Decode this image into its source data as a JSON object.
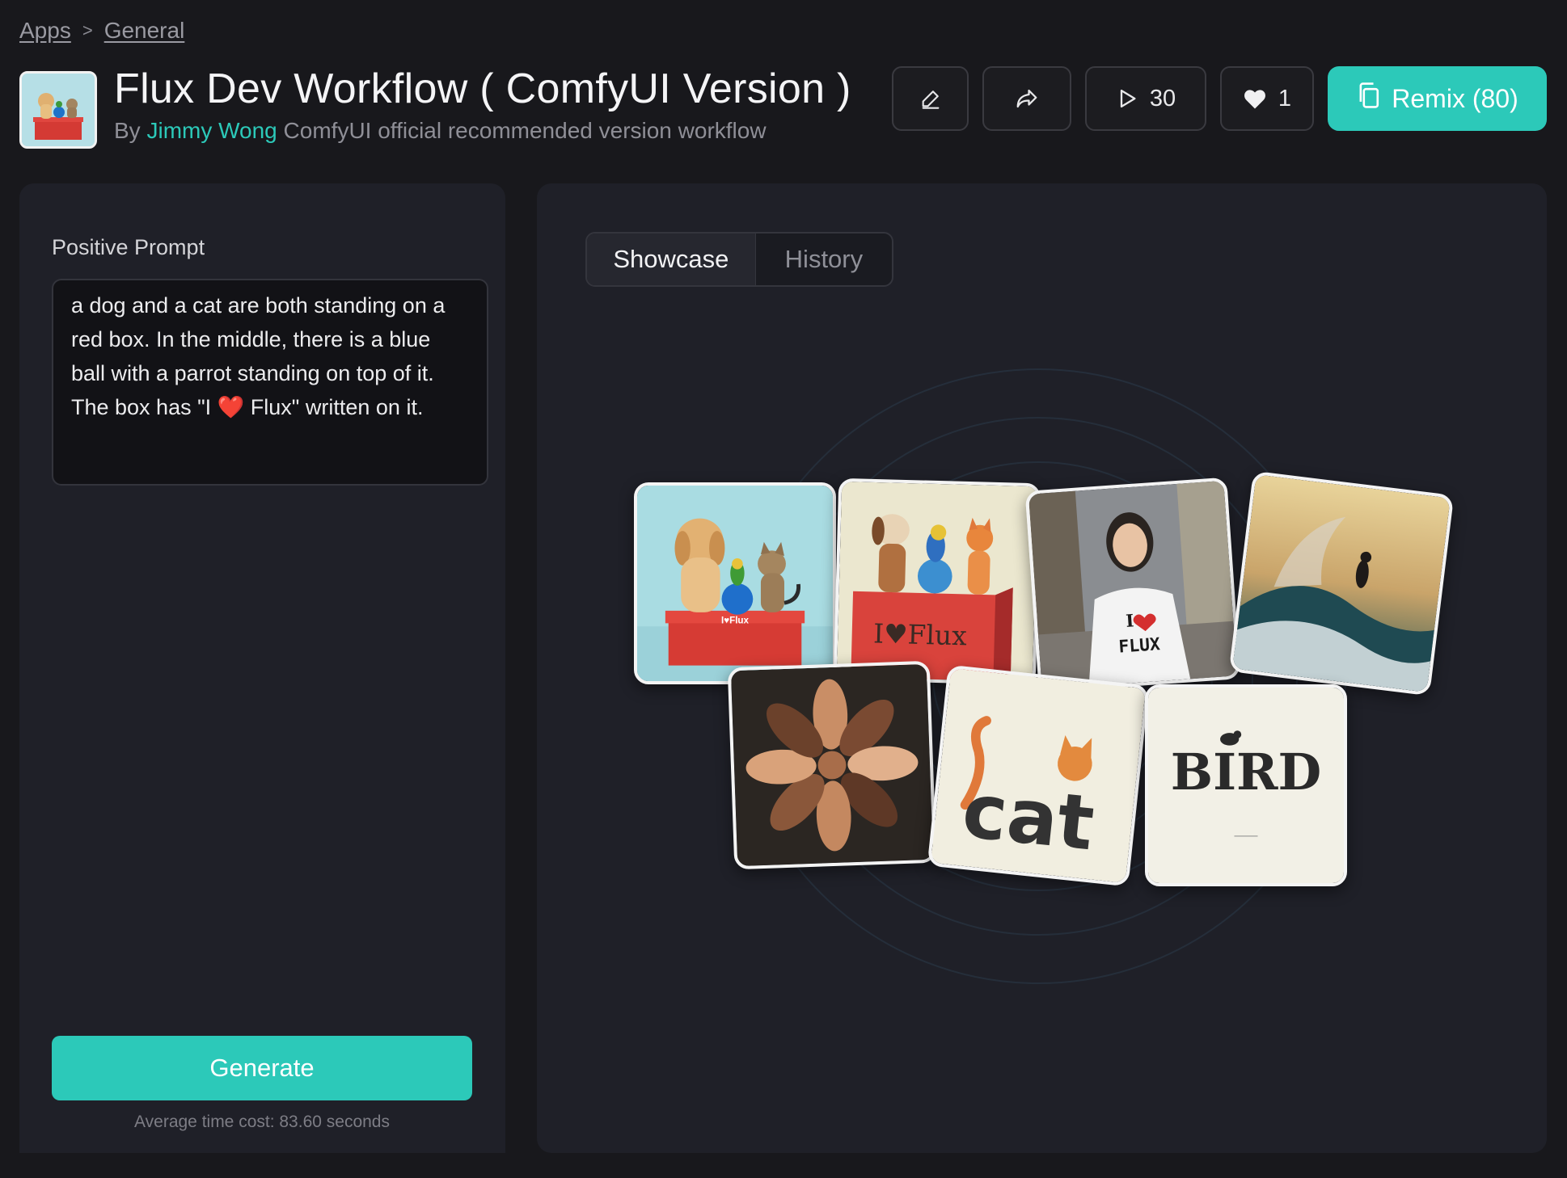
{
  "breadcrumb": {
    "apps": "Apps",
    "separator": ">",
    "current": "General"
  },
  "header": {
    "title": "Flux Dev Workflow ( ComfyUI Version )",
    "by": "By",
    "author": "Jimmy Wong",
    "description": "ComfyUI official recommended version workflow",
    "run_count": "30",
    "like_count": "1",
    "remix_label": "Remix (80)"
  },
  "icons": {
    "edit": "edit-icon",
    "share": "share-icon",
    "play": "play-icon",
    "heart": "heart-icon",
    "copy": "copy-icon"
  },
  "left": {
    "prompt_label": "Positive Prompt",
    "prompt_text": "a dog and a cat are both standing on a red box. In the middle, there is a blue ball with a parrot standing on top of it. The box has \"I ❤️ Flux\" written on it.",
    "generate_label": "Generate",
    "time_cost": "Average time cost: 83.60 seconds"
  },
  "right": {
    "tabs": [
      "Showcase",
      "History"
    ],
    "active_tab": "Showcase",
    "card_texts": {
      "box_small": "I♥Flux",
      "box_large": "I♥Flux",
      "shirt": "FLUX",
      "cat_word": "cat",
      "bird_word": "BIRD"
    }
  },
  "colors": {
    "accent": "#2cc9b9",
    "background": "#18181c",
    "panel": "#1f2028"
  }
}
